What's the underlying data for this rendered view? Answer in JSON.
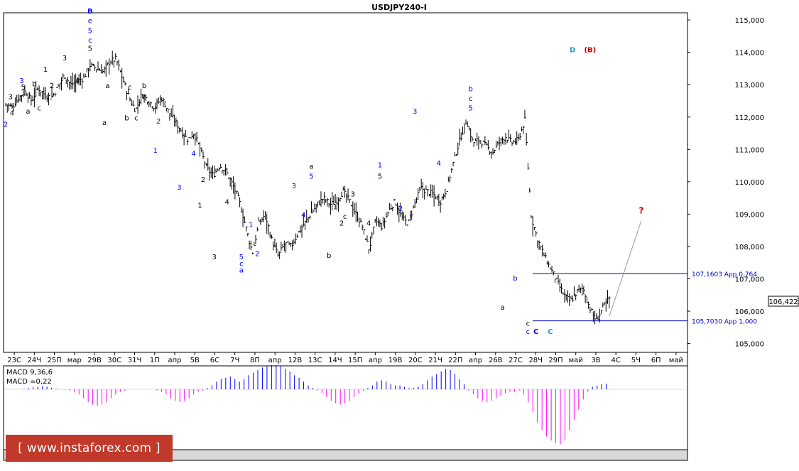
{
  "window_title": "USDJPY240-I",
  "price_tag": "106,422",
  "watermark": "[ www.instaforex.com ]",
  "macd": {
    "params_label": "MACD 9,36,6",
    "value_label": "MACD =0,22",
    "values": [
      0,
      0,
      0,
      0,
      0.02,
      0.05,
      0.08,
      0.1,
      0.12,
      0.1,
      0.06,
      0.02,
      0,
      -0.02,
      -0.05,
      -0.1,
      -0.2,
      -0.35,
      -0.5,
      -0.6,
      -0.65,
      -0.6,
      -0.5,
      -0.35,
      -0.2,
      -0.1,
      -0.05,
      0,
      0,
      0,
      0,
      0,
      0,
      -0.05,
      -0.1,
      -0.2,
      -0.35,
      -0.45,
      -0.5,
      -0.45,
      -0.35,
      -0.2,
      -0.1,
      -0.05,
      0.05,
      0.15,
      0.3,
      0.4,
      0.45,
      0.5,
      0.4,
      0.3,
      0.4,
      0.55,
      0.65,
      0.75,
      0.85,
      0.9,
      0.95,
      0.95,
      0.9,
      0.8,
      0.7,
      0.55,
      0.45,
      0.3,
      0.15,
      0.05,
      -0.05,
      -0.15,
      -0.3,
      -0.45,
      -0.55,
      -0.6,
      -0.55,
      -0.45,
      -0.3,
      -0.15,
      -0.05,
      0.05,
      0.15,
      0.3,
      0.35,
      0.3,
      0.2,
      0.15,
      0.15,
      0.1,
      0.05,
      0.05,
      0.1,
      0.2,
      0.35,
      0.5,
      0.6,
      0.7,
      0.8,
      0.75,
      0.6,
      0.4,
      0.2,
      -0.05,
      -0.2,
      -0.35,
      -0.45,
      -0.5,
      -0.45,
      -0.35,
      -0.25,
      -0.15,
      -0.1,
      -0.1,
      -0.05,
      -0.2,
      -0.5,
      -0.9,
      -1.3,
      -1.6,
      -1.85,
      -2.0,
      -2.1,
      -2.15,
      -2.0,
      -1.6,
      -1.2,
      -0.8,
      -0.4,
      -0.1,
      0.1,
      0.15,
      0.2,
      0.22
    ]
  },
  "chart_data": {
    "type": "line",
    "title": "USDJPY240-I",
    "ylim": [
      104.75,
      115.2
    ],
    "y_ticks": [
      "115,000",
      "114,000",
      "113,000",
      "112,000",
      "111,000",
      "110,000",
      "109,000",
      "108,000",
      "107,000",
      "106,000",
      "105,000"
    ],
    "y_tick_values": [
      115,
      114,
      113,
      112,
      111,
      110,
      109,
      108,
      107,
      106,
      105
    ],
    "x_tick_labels": [
      "23С",
      "24Ч",
      "25П",
      "мар",
      "29В",
      "30С",
      "31Ч",
      "1П",
      "апр",
      "5В",
      "6С",
      "7Ч",
      "8П",
      "апр",
      "12В",
      "13С",
      "14Ч",
      "15П",
      "апр",
      "19В",
      "20С",
      "21Ч",
      "22П",
      "апр",
      "26В",
      "27С",
      "28Ч",
      "29П",
      "май",
      "3В",
      "4С",
      "5Ч",
      "6П",
      "май"
    ],
    "price_path": [
      112.4,
      112.3,
      112.6,
      112.8,
      112.5,
      112.9,
      112.7,
      112.6,
      112.9,
      113.3,
      113.0,
      113.1,
      113.2,
      113.6,
      113.5,
      113.4,
      113.7,
      113.8,
      113.2,
      112.6,
      112.2,
      112.7,
      112.5,
      112.3,
      112.6,
      112.2,
      111.9,
      111.6,
      111.3,
      111.5,
      111.0,
      110.4,
      110.2,
      110.5,
      110.3,
      109.9,
      109.4,
      108.6,
      107.8,
      108.7,
      109.0,
      108.2,
      107.7,
      108.1,
      108.0,
      108.4,
      108.7,
      109.0,
      109.3,
      109.5,
      109.3,
      109.4,
      109.7,
      109.4,
      109.0,
      108.6,
      107.9,
      108.8,
      108.6,
      109.1,
      109.4,
      108.9,
      108.7,
      109.3,
      109.8,
      109.7,
      109.6,
      109.4,
      109.8,
      110.6,
      111.3,
      111.9,
      111.2,
      111.3,
      111.1,
      110.9,
      111.2,
      111.4,
      111.2,
      111.3,
      111.9,
      108.9,
      108.2,
      107.7,
      107.3,
      106.9,
      106.5,
      106.3,
      106.6,
      106.7,
      106.1,
      105.7,
      106.1,
      106.4
    ],
    "levels": [
      {
        "label": "107,1603 App 0,764",
        "value": 107.1603
      },
      {
        "label": "105,7030 App 1,000",
        "value": 105.703
      }
    ],
    "projection": {
      "from": 105.85,
      "to": 108.8,
      "label": "?"
    },
    "wave_labels": [
      {
        "text": "3",
        "x": 3,
        "y": 112.55,
        "color": "#000000"
      },
      {
        "text": "4",
        "x": 4,
        "y": 112.05,
        "color": "#000000"
      },
      {
        "text": "2",
        "x": 0,
        "y": 111.7,
        "color": "#0000ff"
      },
      {
        "text": "3",
        "x": 10,
        "y": 113.05,
        "color": "#0000ff"
      },
      {
        "text": "5",
        "x": 11,
        "y": 112.85,
        "color": "#000000"
      },
      {
        "text": "a",
        "x": 14,
        "y": 112.1,
        "color": "#000000"
      },
      {
        "text": "b",
        "x": 18,
        "y": 112.95,
        "color": "#000000"
      },
      {
        "text": "c",
        "x": 21,
        "y": 112.2,
        "color": "#000000"
      },
      {
        "text": "1",
        "x": 25,
        "y": 113.4,
        "color": "#000000"
      },
      {
        "text": "2",
        "x": 29,
        "y": 112.9,
        "color": "#000000"
      },
      {
        "text": "3",
        "x": 37,
        "y": 113.75,
        "color": "#000000"
      },
      {
        "text": "4",
        "x": 45,
        "y": 113.05,
        "color": "#000000"
      },
      {
        "text": "5",
        "x": 53,
        "y": 114.05,
        "color": "#000000"
      },
      {
        "text": "c",
        "x": 53,
        "y": 114.3,
        "color": "#0000ff"
      },
      {
        "text": "5",
        "x": 53,
        "y": 114.6,
        "color": "#0000ff"
      },
      {
        "text": "e",
        "x": 53,
        "y": 114.9,
        "color": "#0000ff"
      },
      {
        "text": "B",
        "x": 53,
        "y": 115.2,
        "color": "#0000ff"
      },
      {
        "text": "a",
        "x": 64,
        "y": 112.9,
        "color": "#000000"
      },
      {
        "text": "a",
        "x": 62,
        "y": 111.75,
        "color": "#000000"
      },
      {
        "text": "c",
        "x": 78,
        "y": 112.85,
        "color": "#000000"
      },
      {
        "text": "b",
        "x": 76,
        "y": 111.9,
        "color": "#000000"
      },
      {
        "text": "c",
        "x": 82,
        "y": 111.9,
        "color": "#000000"
      },
      {
        "text": "b",
        "x": 87,
        "y": 112.9,
        "color": "#000000"
      },
      {
        "text": "e",
        "x": 87,
        "y": 112.55,
        "color": "#000000"
      },
      {
        "text": "1",
        "x": 94,
        "y": 110.9,
        "color": "#0000ff"
      },
      {
        "text": "2",
        "x": 96,
        "y": 111.8,
        "color": "#0000ff"
      },
      {
        "text": "3",
        "x": 109,
        "y": 109.75,
        "color": "#0000ff"
      },
      {
        "text": "4",
        "x": 118,
        "y": 110.8,
        "color": "#0000ff"
      },
      {
        "text": "2",
        "x": 124,
        "y": 110.0,
        "color": "#000000"
      },
      {
        "text": "1",
        "x": 122,
        "y": 109.2,
        "color": "#000000"
      },
      {
        "text": "3",
        "x": 131,
        "y": 107.6,
        "color": "#000000"
      },
      {
        "text": "4",
        "x": 139,
        "y": 109.3,
        "color": "#000000"
      },
      {
        "text": "5",
        "x": 148,
        "y": 107.6,
        "color": "#0000ff"
      },
      {
        "text": "c",
        "x": 148,
        "y": 107.4,
        "color": "#0000ff"
      },
      {
        "text": "a",
        "x": 148,
        "y": 107.2,
        "color": "#0000ff"
      },
      {
        "text": "1",
        "x": 154,
        "y": 108.6,
        "color": "#0000ff"
      },
      {
        "text": "2",
        "x": 158,
        "y": 107.7,
        "color": "#0000ff"
      },
      {
        "text": "3",
        "x": 181,
        "y": 109.8,
        "color": "#0000ff"
      },
      {
        "text": "4",
        "x": 187,
        "y": 108.9,
        "color": "#0000ff"
      },
      {
        "text": "5",
        "x": 192,
        "y": 110.1,
        "color": "#0000ff"
      },
      {
        "text": "a",
        "x": 192,
        "y": 110.4,
        "color": "#000000"
      },
      {
        "text": "b",
        "x": 203,
        "y": 107.65,
        "color": "#000000"
      },
      {
        "text": "1",
        "x": 207,
        "y": 109.15,
        "color": "#000000"
      },
      {
        "text": "2",
        "x": 211,
        "y": 108.65,
        "color": "#000000"
      },
      {
        "text": "c",
        "x": 213,
        "y": 108.85,
        "color": "#000000"
      },
      {
        "text": "3",
        "x": 218,
        "y": 109.55,
        "color": "#000000"
      },
      {
        "text": "4",
        "x": 228,
        "y": 108.65,
        "color": "#000000"
      },
      {
        "text": "5",
        "x": 235,
        "y": 110.1,
        "color": "#000000"
      },
      {
        "text": "1",
        "x": 235,
        "y": 110.45,
        "color": "#0000ff"
      },
      {
        "text": "2",
        "x": 248,
        "y": 109.1,
        "color": "#0000ff"
      },
      {
        "text": "3",
        "x": 257,
        "y": 112.1,
        "color": "#0000ff"
      },
      {
        "text": "4",
        "x": 272,
        "y": 110.5,
        "color": "#0000ff"
      },
      {
        "text": "5",
        "x": 292,
        "y": 112.2,
        "color": "#0000ff"
      },
      {
        "text": "c",
        "x": 292,
        "y": 112.5,
        "color": "#000000"
      },
      {
        "text": "b",
        "x": 292,
        "y": 112.8,
        "color": "#0000ff"
      },
      {
        "text": "a",
        "x": 312,
        "y": 106.05,
        "color": "#000000"
      },
      {
        "text": "b",
        "x": 320,
        "y": 106.95,
        "color": "#0000ff"
      },
      {
        "text": "c",
        "x": 328,
        "y": 105.55,
        "color": "#000000"
      },
      {
        "text": "c",
        "x": 328,
        "y": 105.3,
        "color": "#0000ff"
      },
      {
        "text": "C",
        "x": 333,
        "y": 105.3,
        "color": "#0000ff"
      },
      {
        "text": "C",
        "x": 342,
        "y": 105.3,
        "color": "#1e9ed6"
      },
      {
        "text": "D",
        "x": 356,
        "y": 114.0,
        "color": "#1e9ed6"
      },
      {
        "text": "(B)",
        "x": 367,
        "y": 114.0,
        "color": "#cc0000"
      }
    ]
  }
}
